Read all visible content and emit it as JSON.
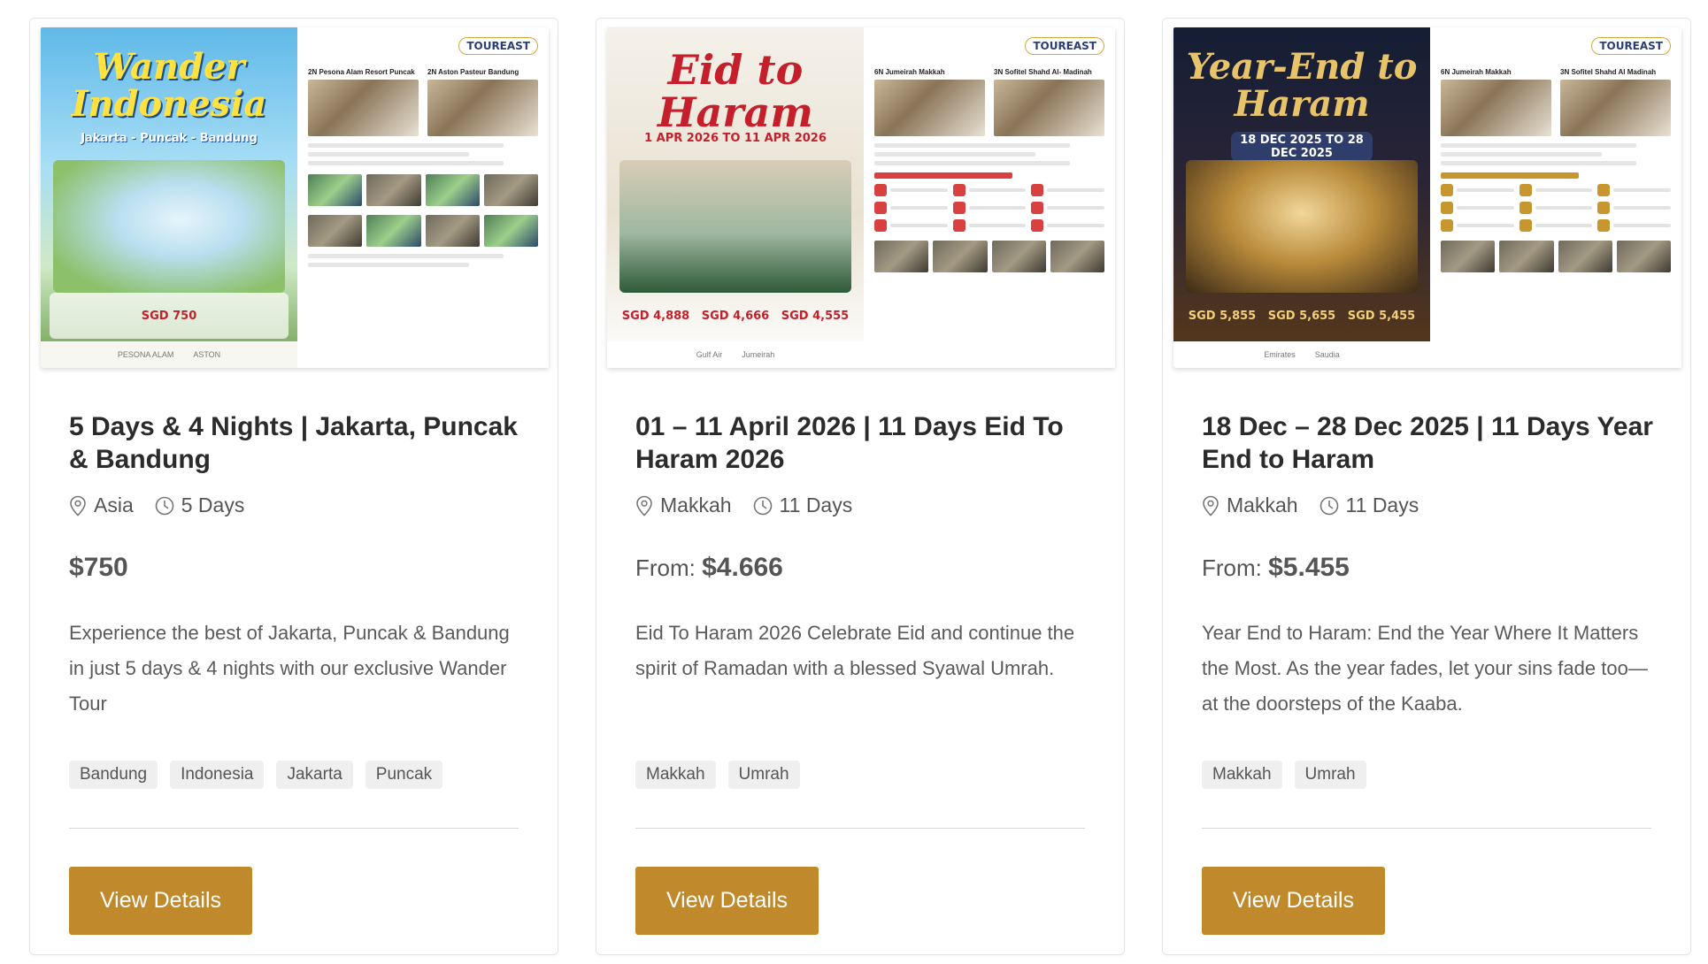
{
  "cards": [
    {
      "title": "5 Days & 4 Nights | Jakarta, Puncak & Bandung",
      "location": "Asia",
      "duration": "5 Days",
      "price_prefix": "",
      "price": "$750",
      "description": "Experience the best of Jakarta, Puncak & Bandung in just 5 days & 4 nights with our exclusive Wander Tour",
      "tags": [
        "Bandung",
        "Indonesia",
        "Jakarta",
        "Puncak"
      ],
      "button_label": "View Details",
      "poster": {
        "title": "Wander Indonesia",
        "subtitle": "Jakarta - Puncak - Bandung",
        "price": "SGD 750",
        "brand": "TOUREAST",
        "hotel_1": "2N Pesona Alam Resort Puncak",
        "hotel_2": "2N Aston Pasteur Bandung",
        "footer_1": "PESONA ALAM",
        "footer_2": "ASTON"
      }
    },
    {
      "title": "01 – 11 April 2026 | 11 Days Eid To Haram 2026",
      "location": "Makkah",
      "duration": "11 Days",
      "price_prefix": "From: ",
      "price": "$4.666",
      "description": "Eid To Haram 2026 Celebrate Eid and continue the spirit of Ramadan with a blessed Syawal Umrah.",
      "tags": [
        "Makkah",
        "Umrah"
      ],
      "button_label": "View Details",
      "poster": {
        "title": "Eid to Haram",
        "subtitle": "1 APR 2026 TO 11 APR 2026",
        "price_1": "SGD 4,888",
        "price_2": "SGD 4,666",
        "price_3": "SGD 4,555",
        "brand": "TOUREAST",
        "hotel_1": "6N Jumeirah Makkah",
        "hotel_2": "3N Sofitel Shahd Al- Madinah",
        "footer_1": "Gulf Air",
        "footer_2": "Jumeirah"
      }
    },
    {
      "title": "18 Dec – 28 Dec 2025 | 11 Days Year End to Haram",
      "location": "Makkah",
      "duration": "11 Days",
      "price_prefix": "From: ",
      "price": "$5.455",
      "description": "Year End to Haram: End the Year Where It Matters the Most. As the year fades, let your sins fade too—at the doorsteps of the Kaaba.",
      "tags": [
        "Makkah",
        "Umrah"
      ],
      "button_label": "View Details",
      "poster": {
        "title": "Year-End to Haram",
        "subtitle": "18 DEC 2025 TO 28 DEC 2025",
        "price_1": "SGD 5,855",
        "price_2": "SGD 5,655",
        "price_3": "SGD 5,455",
        "brand": "TOUREAST",
        "hotel_1": "6N Jumeirah Makkah",
        "hotel_2": "3N Sofitel Shahd Al Madinah",
        "footer_1": "Emirates",
        "footer_2": "Saudia"
      }
    }
  ],
  "icons": {
    "location": "map-pin-icon",
    "duration": "clock-icon"
  },
  "colors": {
    "button": "#c08a2c",
    "tag_bg": "#efefef",
    "title": "#2b2b2b"
  }
}
